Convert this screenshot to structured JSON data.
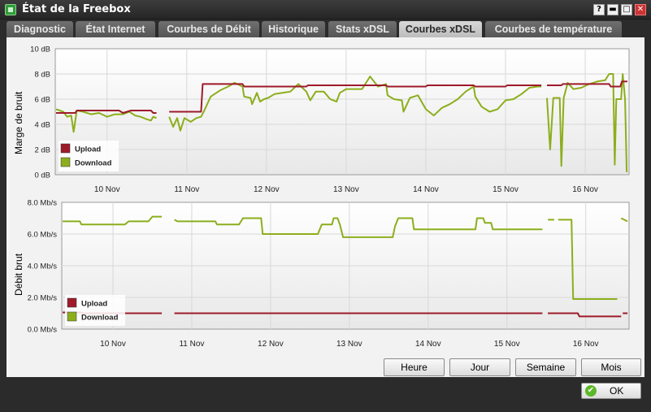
{
  "window": {
    "title": "État de la Freebox",
    "help_label": "?",
    "minimize_label": "▬",
    "maximize_label": "□",
    "close_label": "✕"
  },
  "tabs": [
    {
      "label": "Diagnostic",
      "active": false
    },
    {
      "label": "État Internet",
      "active": false
    },
    {
      "label": "Courbes de Débit",
      "active": false
    },
    {
      "label": "Historique",
      "active": false
    },
    {
      "label": "Stats xDSL",
      "active": false
    },
    {
      "label": "Courbes xDSL",
      "active": true
    },
    {
      "label": "Courbes de température",
      "active": false
    }
  ],
  "buttons": {
    "heure": "Heure",
    "jour": "Jour",
    "semaine": "Semaine",
    "mois": "Mois",
    "ok": "OK"
  },
  "colors": {
    "upload": "#9e1b2a",
    "download": "#8cae1c"
  },
  "chart_data": [
    {
      "type": "line",
      "ylabel": "Marge de bruit",
      "yunit": "dB",
      "ylim": [
        0,
        10
      ],
      "yticks": [
        "0 dB",
        "2 dB",
        "4 dB",
        "6 dB",
        "8 dB",
        "10 dB"
      ],
      "xlim": [
        9.35,
        16.55
      ],
      "xticks": [
        {
          "label": "10 Nov",
          "x": 10
        },
        {
          "label": "11 Nov",
          "x": 11
        },
        {
          "label": "12 Nov",
          "x": 12
        },
        {
          "label": "13 Nov",
          "x": 13
        },
        {
          "label": "14 Nov",
          "x": 14
        },
        {
          "label": "15 Nov",
          "x": 15
        },
        {
          "label": "16 Nov",
          "x": 16
        }
      ],
      "legend": {
        "position": "bottom-left",
        "entries": [
          "Upload",
          "Download"
        ]
      },
      "series": [
        {
          "name": "Upload",
          "segments": [
            [
              [
                9.36,
                4.9
              ],
              [
                9.6,
                4.9
              ],
              [
                9.62,
                5.1
              ],
              [
                9.9,
                5.1
              ],
              [
                10.15,
                5.1
              ],
              [
                10.2,
                4.9
              ],
              [
                10.3,
                5.1
              ],
              [
                10.55,
                5.1
              ],
              [
                10.58,
                4.9
              ],
              [
                10.62,
                4.9
              ]
            ],
            [
              [
                10.78,
                5.0
              ],
              [
                11.18,
                5.0
              ],
              [
                11.2,
                7.2
              ],
              [
                11.7,
                7.2
              ],
              [
                11.72,
                7.0
              ],
              [
                12.5,
                7.0
              ],
              [
                12.52,
                7.1
              ],
              [
                13.5,
                7.1
              ],
              [
                13.52,
                7.0
              ],
              [
                14.0,
                7.0
              ],
              [
                14.02,
                7.1
              ],
              [
                14.6,
                7.1
              ],
              [
                14.62,
                7.0
              ],
              [
                15.0,
                7.0
              ],
              [
                15.02,
                7.1
              ],
              [
                15.45,
                7.1
              ]
            ],
            [
              [
                15.52,
                7.1
              ],
              [
                15.7,
                7.1
              ],
              [
                15.72,
                7.2
              ],
              [
                16.3,
                7.2
              ],
              [
                16.32,
                7.0
              ],
              [
                16.44,
                7.0
              ],
              [
                16.46,
                7.4
              ],
              [
                16.53,
                7.4
              ]
            ]
          ]
        },
        {
          "name": "Download",
          "segments": [
            [
              [
                9.36,
                5.2
              ],
              [
                9.45,
                5.0
              ],
              [
                9.5,
                4.6
              ],
              [
                9.55,
                4.7
              ],
              [
                9.58,
                3.4
              ],
              [
                9.62,
                5.1
              ],
              [
                9.7,
                5.0
              ],
              [
                9.8,
                4.8
              ],
              [
                9.9,
                4.9
              ],
              [
                10.0,
                4.6
              ],
              [
                10.1,
                4.8
              ],
              [
                10.2,
                4.8
              ],
              [
                10.28,
                5.0
              ],
              [
                10.35,
                4.7
              ],
              [
                10.42,
                4.6
              ],
              [
                10.5,
                4.4
              ],
              [
                10.55,
                4.3
              ],
              [
                10.58,
                4.6
              ],
              [
                10.62,
                4.5
              ]
            ],
            [
              [
                10.78,
                4.6
              ],
              [
                10.83,
                3.8
              ],
              [
                10.88,
                4.5
              ],
              [
                10.92,
                3.5
              ],
              [
                10.97,
                4.5
              ],
              [
                11.05,
                4.2
              ],
              [
                11.12,
                4.5
              ],
              [
                11.18,
                4.6
              ],
              [
                11.22,
                5.1
              ],
              [
                11.3,
                6.2
              ],
              [
                11.42,
                6.7
              ],
              [
                11.52,
                7.0
              ],
              [
                11.6,
                7.3
              ],
              [
                11.7,
                7.0
              ],
              [
                11.72,
                6.2
              ],
              [
                11.8,
                6.1
              ],
              [
                11.82,
                5.6
              ],
              [
                11.88,
                6.5
              ],
              [
                11.92,
                5.8
              ],
              [
                11.97,
                6.0
              ],
              [
                12.02,
                6.1
              ],
              [
                12.1,
                6.4
              ],
              [
                12.2,
                6.5
              ],
              [
                12.3,
                6.6
              ],
              [
                12.4,
                7.2
              ],
              [
                12.5,
                6.6
              ],
              [
                12.55,
                5.9
              ],
              [
                12.62,
                6.6
              ],
              [
                12.72,
                6.6
              ],
              [
                12.8,
                6.0
              ],
              [
                12.88,
                5.8
              ],
              [
                12.92,
                6.5
              ],
              [
                13.0,
                6.8
              ],
              [
                13.1,
                6.8
              ],
              [
                13.2,
                6.8
              ],
              [
                13.3,
                7.8
              ],
              [
                13.4,
                7.0
              ],
              [
                13.5,
                7.2
              ],
              [
                13.52,
                6.3
              ],
              [
                13.6,
                6.0
              ],
              [
                13.7,
                5.9
              ],
              [
                13.72,
                5.0
              ],
              [
                13.8,
                6.1
              ],
              [
                13.9,
                6.3
              ],
              [
                14.0,
                5.2
              ],
              [
                14.1,
                4.7
              ],
              [
                14.2,
                5.3
              ],
              [
                14.3,
                5.6
              ],
              [
                14.4,
                6.0
              ],
              [
                14.5,
                6.6
              ],
              [
                14.6,
                7.0
              ],
              [
                14.62,
                6.2
              ],
              [
                14.7,
                5.4
              ],
              [
                14.8,
                5.0
              ],
              [
                14.9,
                5.2
              ],
              [
                15.0,
                5.9
              ],
              [
                15.1,
                6.0
              ],
              [
                15.2,
                6.4
              ],
              [
                15.3,
                6.9
              ],
              [
                15.4,
                7.0
              ],
              [
                15.45,
                7.0
              ]
            ],
            [
              [
                15.52,
                6.1
              ],
              [
                15.56,
                2.0
              ],
              [
                15.6,
                6.1
              ],
              [
                15.68,
                6.1
              ],
              [
                15.7,
                0.7
              ],
              [
                15.73,
                6.1
              ],
              [
                15.78,
                7.3
              ],
              [
                15.85,
                6.8
              ],
              [
                15.95,
                6.9
              ],
              [
                16.05,
                7.2
              ],
              [
                16.15,
                7.4
              ],
              [
                16.25,
                7.5
              ],
              [
                16.3,
                8.0
              ],
              [
                16.35,
                8.0
              ],
              [
                16.37,
                0.8
              ],
              [
                16.39,
                6.0
              ],
              [
                16.45,
                6.0
              ],
              [
                16.47,
                8.0
              ],
              [
                16.5,
                6.0
              ],
              [
                16.52,
                0.2
              ]
            ]
          ]
        }
      ]
    },
    {
      "type": "line",
      "ylabel": "Débit brut",
      "yunit": "Mb/s",
      "ylim": [
        0,
        8
      ],
      "yticks": [
        "0.0 Mb/s",
        "2.0 Mb/s",
        "4.0 Mb/s",
        "6.0 Mb/s",
        "8.0 Mb/s"
      ],
      "xlim": [
        9.35,
        16.55
      ],
      "xticks": [
        {
          "label": "10 Nov",
          "x": 10
        },
        {
          "label": "11 Nov",
          "x": 11
        },
        {
          "label": "12 Nov",
          "x": 12
        },
        {
          "label": "13 Nov",
          "x": 13
        },
        {
          "label": "14 Nov",
          "x": 14
        },
        {
          "label": "15 Nov",
          "x": 15
        },
        {
          "label": "16 Nov",
          "x": 16
        }
      ],
      "legend": {
        "position": "bottom-left",
        "entries": [
          "Upload",
          "Download"
        ]
      },
      "series": [
        {
          "name": "Upload",
          "segments": [
            [
              [
                9.36,
                1.05
              ],
              [
                9.6,
                1.05
              ],
              [
                9.62,
                1.0
              ],
              [
                10.62,
                1.0
              ]
            ],
            [
              [
                10.78,
                1.0
              ],
              [
                15.45,
                1.0
              ]
            ],
            [
              [
                15.52,
                1.0
              ],
              [
                15.9,
                1.0
              ],
              [
                15.92,
                0.8
              ],
              [
                16.45,
                0.8
              ]
            ],
            [
              [
                16.47,
                1.0
              ],
              [
                16.53,
                1.0
              ]
            ]
          ]
        },
        {
          "name": "Download",
          "segments": [
            [
              [
                9.36,
                6.8
              ],
              [
                9.58,
                6.8
              ],
              [
                9.6,
                6.6
              ],
              [
                10.15,
                6.6
              ],
              [
                10.2,
                6.8
              ],
              [
                10.45,
                6.8
              ],
              [
                10.5,
                7.1
              ],
              [
                10.62,
                7.1
              ]
            ],
            [
              [
                10.78,
                6.9
              ],
              [
                10.82,
                6.8
              ],
              [
                11.3,
                6.8
              ],
              [
                11.32,
                6.6
              ],
              [
                11.6,
                6.6
              ],
              [
                11.65,
                7.0
              ],
              [
                11.88,
                7.0
              ],
              [
                11.9,
                6.0
              ],
              [
                12.6,
                6.0
              ],
              [
                12.65,
                6.6
              ],
              [
                12.78,
                6.6
              ],
              [
                12.8,
                7.0
              ],
              [
                12.85,
                7.0
              ],
              [
                12.88,
                6.6
              ],
              [
                12.92,
                5.8
              ],
              [
                13.55,
                5.8
              ],
              [
                13.58,
                6.5
              ],
              [
                13.62,
                7.0
              ],
              [
                13.8,
                7.0
              ],
              [
                13.82,
                6.3
              ],
              [
                14.6,
                6.3
              ],
              [
                14.62,
                7.0
              ],
              [
                14.7,
                7.0
              ],
              [
                14.72,
                6.7
              ],
              [
                14.8,
                6.7
              ],
              [
                14.82,
                6.3
              ],
              [
                15.45,
                6.3
              ]
            ],
            [
              [
                15.52,
                6.9
              ],
              [
                15.6,
                6.9
              ]
            ],
            [
              [
                15.65,
                6.9
              ],
              [
                15.72,
                6.9
              ],
              [
                15.82,
                6.9
              ],
              [
                15.84,
                1.9
              ],
              [
                16.4,
                1.9
              ]
            ],
            [
              [
                16.45,
                7.0
              ],
              [
                16.53,
                6.8
              ]
            ]
          ]
        }
      ]
    }
  ]
}
